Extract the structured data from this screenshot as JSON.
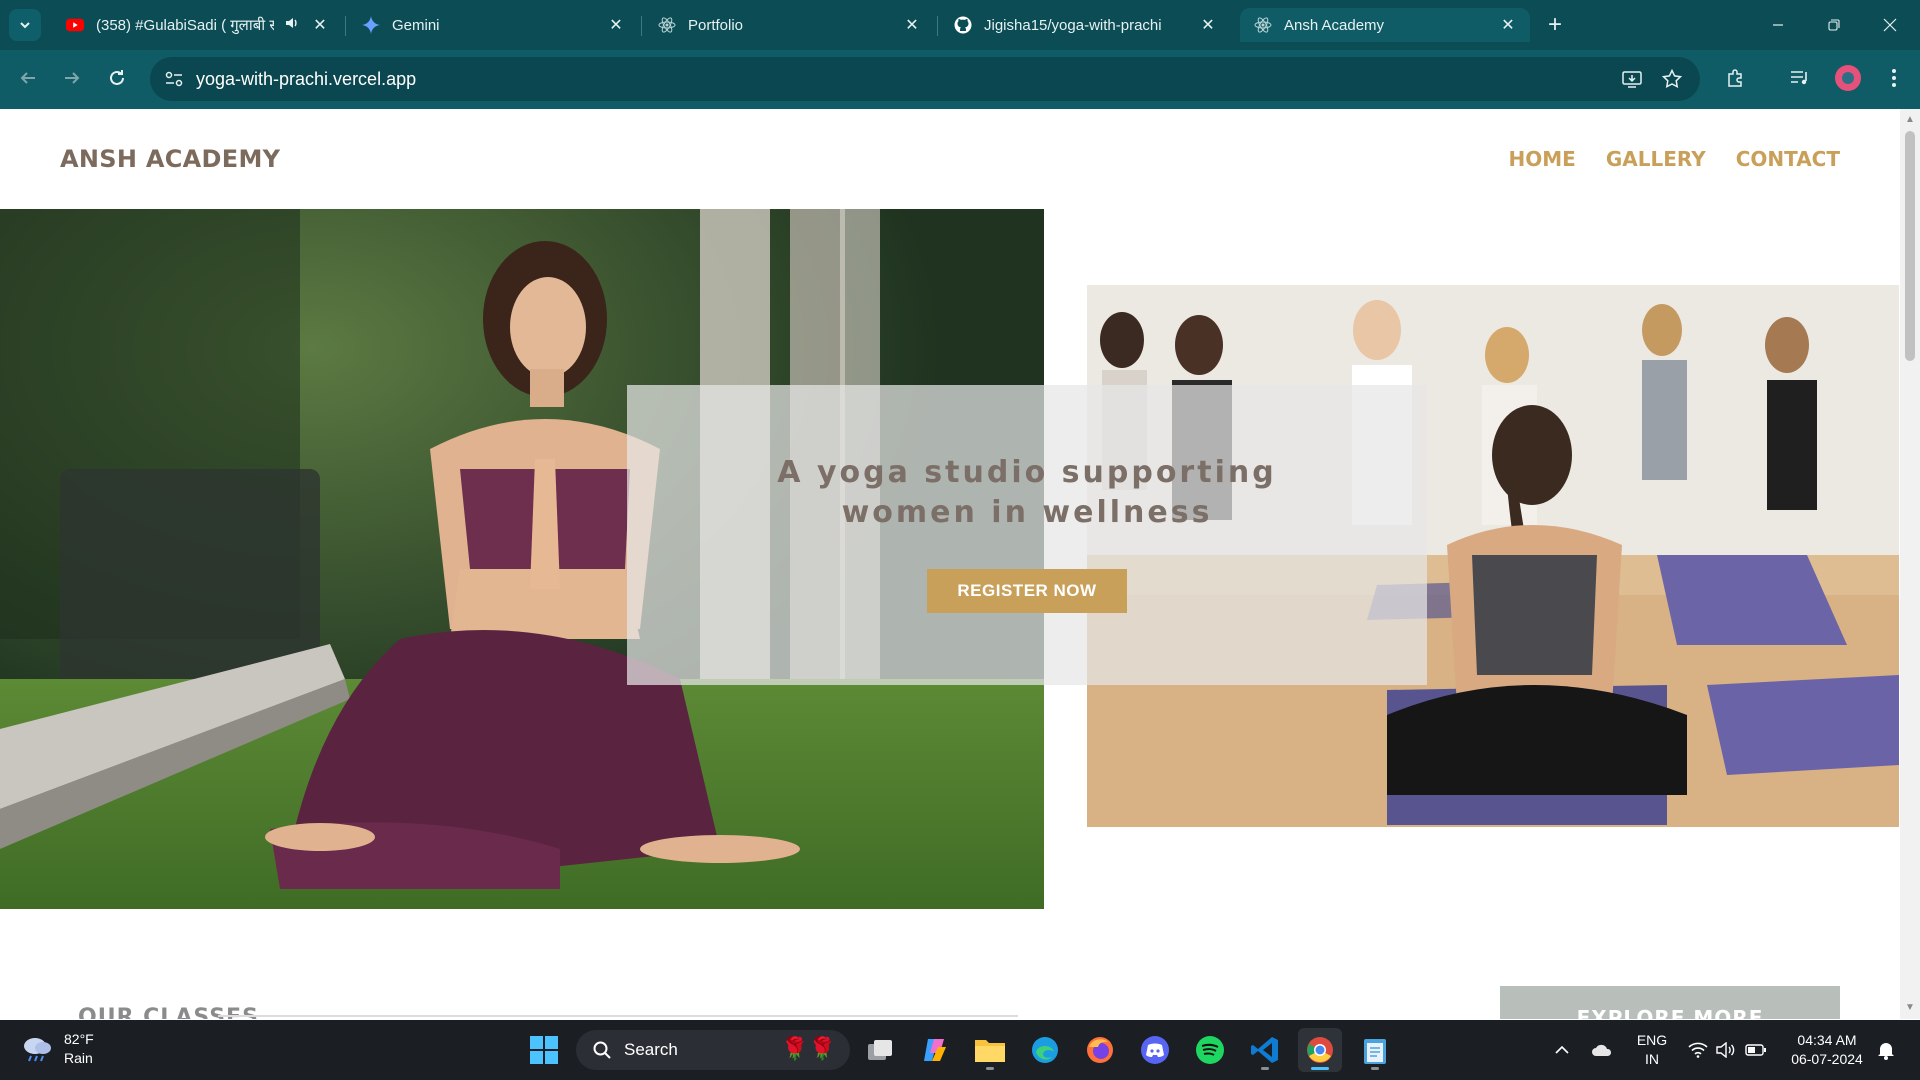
{
  "browser": {
    "tabs": [
      {
        "title": "(358) #GulabiSadi ( गुलाबी सा",
        "favicon": "youtube-icon",
        "audio": true
      },
      {
        "title": "Gemini",
        "favicon": "gemini-icon"
      },
      {
        "title": "Portfolio",
        "favicon": "react-icon"
      },
      {
        "title": "Jigisha15/yoga-with-prachi",
        "favicon": "github-icon"
      },
      {
        "title": "Ansh Academy",
        "favicon": "react-icon",
        "active": true
      }
    ],
    "url": "yoga-with-prachi.vercel.app",
    "theme_color": "#0c4c55"
  },
  "site": {
    "brand": "ANSH ACADEMY",
    "nav": [
      "HOME",
      "GALLERY",
      "CONTACT"
    ],
    "hero": {
      "heading_line1": "A yoga studio supporting",
      "heading_line2": "women in wellness",
      "cta_label": "REGISTER NOW",
      "left_image": "woman meditating on grass",
      "right_image": "group yoga class meditating"
    },
    "section_label": "OUR CLASSES",
    "explore_label": "EXPLORE MORE",
    "accent_color": "#c9a05a",
    "brand_color": "#7c6b5d"
  },
  "taskbar": {
    "weather_temp": "82°F",
    "weather_desc": "Rain",
    "search_placeholder": "Search",
    "lang_line1": "ENG",
    "lang_line2": "IN",
    "time": "04:34 AM",
    "date": "06-07-2024"
  }
}
